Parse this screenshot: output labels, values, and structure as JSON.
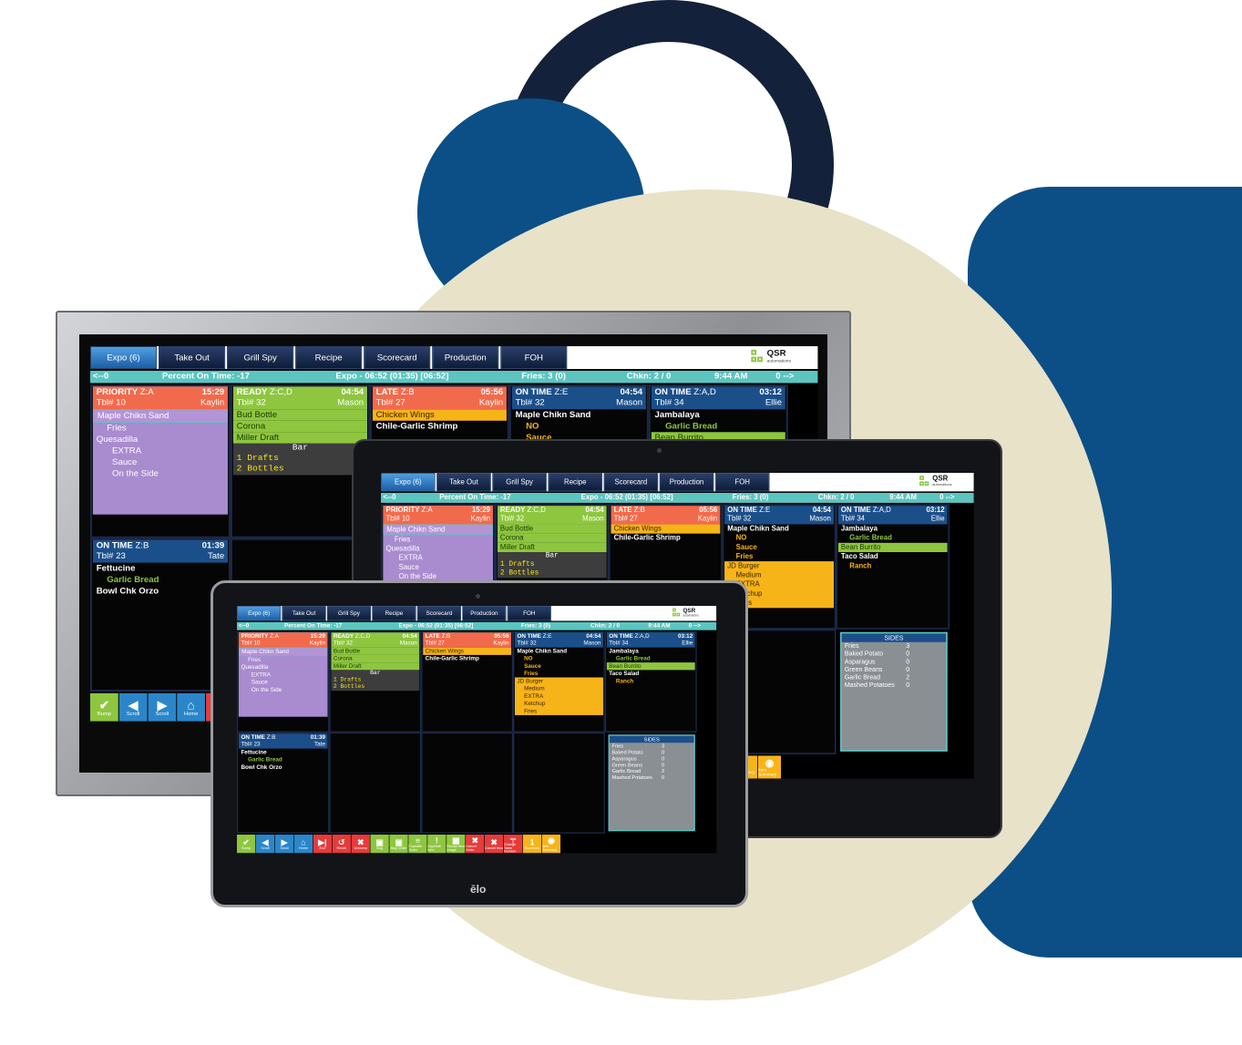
{
  "colors": {
    "accent": "#5cc5c0",
    "priority": "#f26a4c",
    "ready": "#8ec63f",
    "ontime": "#1b4f8a",
    "modifier": "#f7b419"
  },
  "tabs": [
    "Expo (6)",
    "Take Out",
    "Grill Spy",
    "Recipe",
    "Scorecard",
    "Production",
    "FOH"
  ],
  "logo": {
    "name": "QSR",
    "tagline": "automations"
  },
  "status": {
    "prev": "<--0",
    "percent": "Percent On Time: -17",
    "expo": "Expo  - 06:52  (01:35)  [06:52]",
    "fries": "Fries: 3  (0)",
    "chkn": "Chkn: 2 / 0",
    "time": "9:44 AM",
    "next": "0 -->"
  },
  "tickets": {
    "t1": {
      "status": "PRIORITY",
      "zone": "Z:A",
      "time": "15:29",
      "table": "Tbl# 10",
      "server": "Kaylin",
      "items": [
        "Maple Chikn Sand",
        "Fries",
        "Quesadilla",
        "EXTRA",
        "Sauce",
        "On the Side"
      ]
    },
    "t2": {
      "status": "READY",
      "zone": "Z:C,D",
      "time": "04:54",
      "table": "Tbl# 32",
      "server": "Mason",
      "items": [
        "Bud Bottle",
        "Corona",
        "Miller Draft"
      ],
      "bar_title": "Bar",
      "bar_lines": [
        "1 Drafts",
        "2 Bottles"
      ]
    },
    "t3": {
      "status": "LATE",
      "zone": "Z:B",
      "time": "05:56",
      "table": "Tbl# 27",
      "server": "Kaylin",
      "items": [
        "Chicken Wings",
        "Chile-Garlic Shrimp"
      ]
    },
    "t4": {
      "status": "ON TIME",
      "zone": "Z:E",
      "time": "04:54",
      "table": "Tbl# 32",
      "server": "Mason",
      "items": [
        "Maple Chikn Sand",
        "NO",
        "Sauce",
        "Fries",
        "JD Burger",
        "Medium",
        "EXTRA",
        "Ketchup",
        "Fries"
      ]
    },
    "t5": {
      "status": "ON TIME",
      "zone": "Z:A,D",
      "time": "03:12",
      "table": "Tbl# 34",
      "server": "Ellie",
      "items": [
        "Jambalaya",
        "Garlic Bread",
        "Bean Burrito",
        "Taco Salad",
        "Ranch"
      ]
    },
    "t6": {
      "status": "ON TIME",
      "zone": "Z:B",
      "time": "01:39",
      "table": "Tbl# 23",
      "server": "Tate",
      "items": [
        "Fettucine",
        "Garlic Bread",
        "Bowl Chk Orzo"
      ]
    }
  },
  "sides": {
    "title": "SIDES",
    "rows": [
      {
        "name": "Fries",
        "qty": "3"
      },
      {
        "name": "Baked Potato",
        "qty": "0"
      },
      {
        "name": "Asparagus",
        "qty": "0"
      },
      {
        "name": "Green Beans",
        "qty": "0"
      },
      {
        "name": "Garlic Bread",
        "qty": "2"
      },
      {
        "name": "Mashed Potatoes",
        "qty": "0"
      }
    ]
  },
  "toolbar": [
    {
      "label": "Bump",
      "icon": "check-icon",
      "glyph": "✔",
      "color": "green"
    },
    {
      "label": "Scroll",
      "icon": "arrow-left-icon",
      "glyph": "◀",
      "color": "blue"
    },
    {
      "label": "Scroll",
      "icon": "arrow-right-icon",
      "glyph": "▶",
      "color": "blue"
    },
    {
      "label": "Home",
      "icon": "home-icon",
      "glyph": "⌂",
      "color": "blue"
    },
    {
      "label": "End",
      "icon": "end-icon",
      "glyph": "▶|",
      "color": "red"
    },
    {
      "label": "Recall",
      "icon": "recall-icon",
      "glyph": "↺",
      "color": "red"
    },
    {
      "label": "Unbump",
      "icon": "unbump-icon",
      "glyph": "✖",
      "color": "red"
    },
    {
      "label": "Bag",
      "icon": "bag-icon",
      "glyph": "▣",
      "color": "gr2"
    },
    {
      "label": "Bag Order",
      "icon": "bag-order-icon",
      "glyph": "▣",
      "color": "gr2"
    },
    {
      "label": "Expedite Order",
      "icon": "expedite-icon",
      "glyph": "≡",
      "color": "gr2"
    },
    {
      "label": "Expedite Item",
      "icon": "expedite-item-icon",
      "glyph": "!",
      "color": "gr2"
    },
    {
      "label": "Recipe Item Image",
      "icon": "recipe-image-icon",
      "glyph": "▦",
      "color": "gr2"
    },
    {
      "label": "Cancel Order",
      "icon": "cancel-order-icon",
      "glyph": "✖",
      "color": "red"
    },
    {
      "label": "Cancel Item",
      "icon": "cancel-item-icon",
      "glyph": "✖",
      "color": "red"
    },
    {
      "label": "Change Table Number",
      "icon": "table-icon",
      "glyph": "╤",
      "color": "red"
    },
    {
      "label": "Summary",
      "icon": "summary-icon",
      "glyph": "1",
      "color": "yel"
    },
    {
      "label": "Item Summary",
      "icon": "item-summary-icon",
      "glyph": "◉",
      "color": "yel"
    }
  ],
  "brand": "ēlo"
}
